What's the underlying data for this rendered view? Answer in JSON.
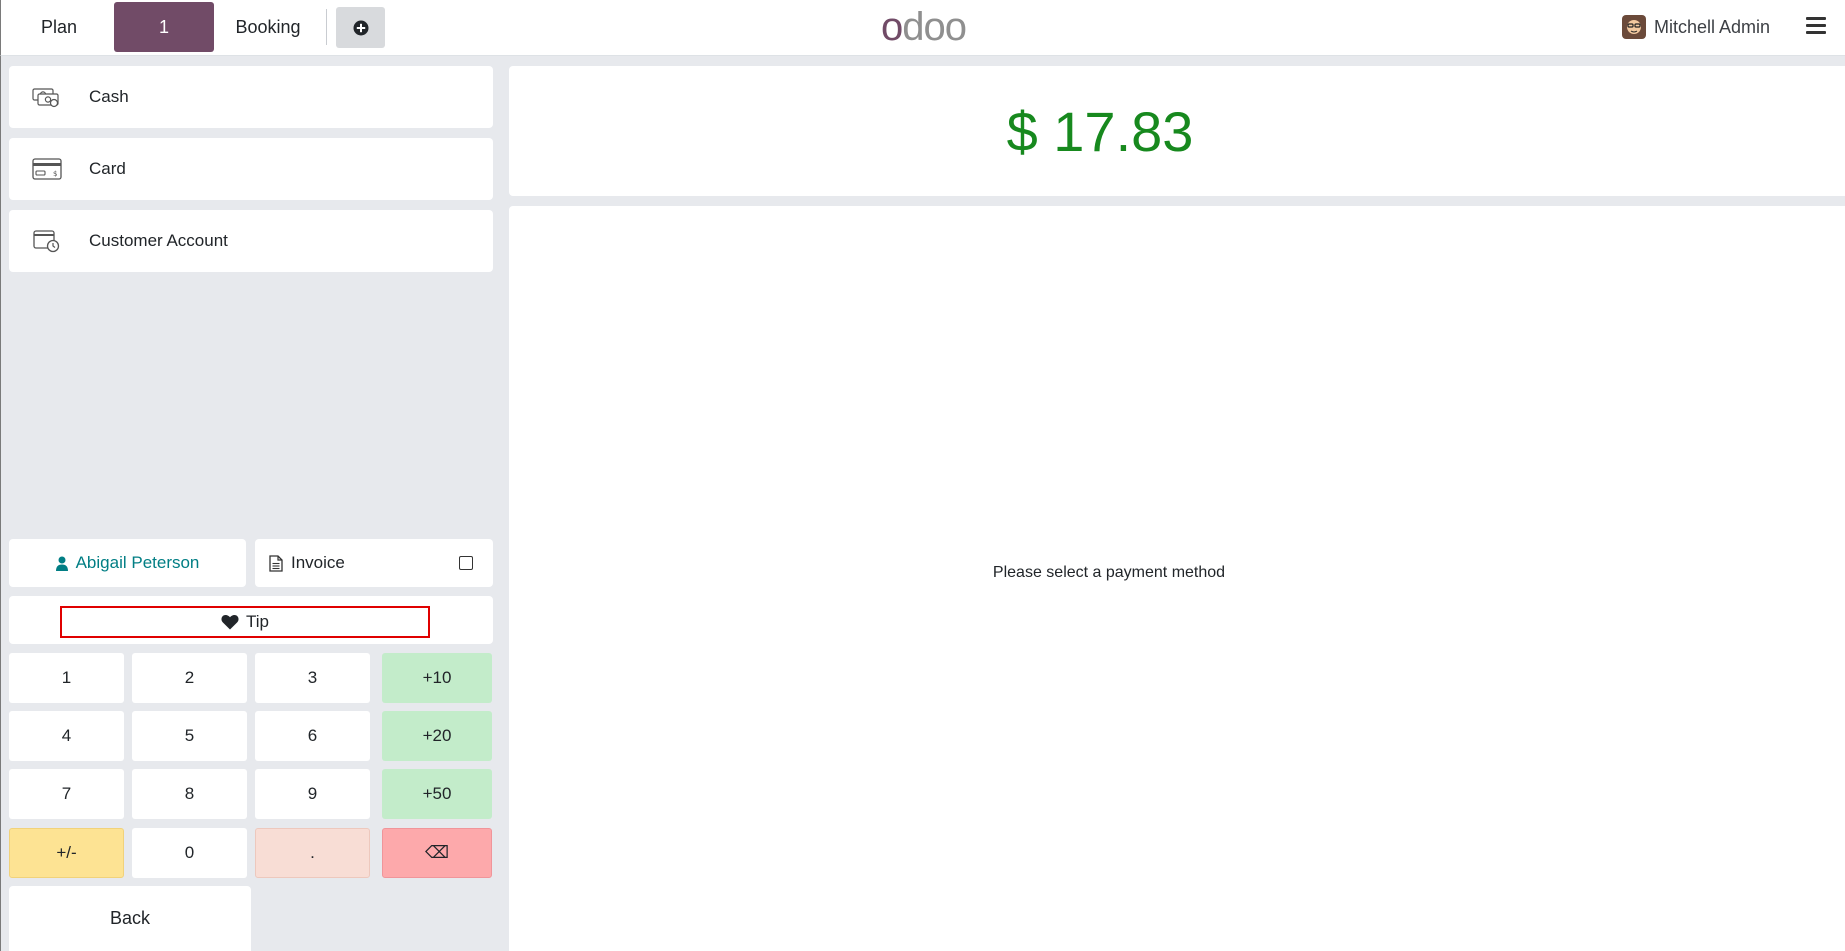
{
  "navbar": {
    "plan_label": "Plan",
    "order_tab_label": "1",
    "booking_label": "Booking",
    "logo_first": "o",
    "logo_rest": "doo",
    "user_name": "Mitchell Admin"
  },
  "payment_methods": [
    {
      "label": "Cash",
      "icon": "cash-icon"
    },
    {
      "label": "Card",
      "icon": "card-icon"
    },
    {
      "label": "Customer Account",
      "icon": "customer-account-icon"
    }
  ],
  "customer": {
    "name": "Abigail Peterson",
    "icon": "user-icon"
  },
  "invoice": {
    "label": "Invoice",
    "checked": false
  },
  "tip": {
    "label": "Tip",
    "icon": "heart-icon"
  },
  "numpad": {
    "rows": [
      [
        "1",
        "2",
        "3",
        "+10"
      ],
      [
        "4",
        "5",
        "6",
        "+20"
      ],
      [
        "7",
        "8",
        "9",
        "+50"
      ],
      [
        "+/-",
        "0",
        ".",
        "⌫"
      ]
    ]
  },
  "back_label": "Back",
  "total": {
    "amount": "$ 17.83"
  },
  "payment_detail": {
    "message": "Please select a payment method"
  },
  "colors": {
    "brand": "#714b67",
    "total_green": "#17891e",
    "customer_teal": "#017e84",
    "quick_add_green": "#c3ecca",
    "sign_yellow": "#fde393",
    "decimal_peach": "#f8ddd5",
    "backspace_red": "#fda9ab",
    "highlight_red": "#e00000"
  }
}
